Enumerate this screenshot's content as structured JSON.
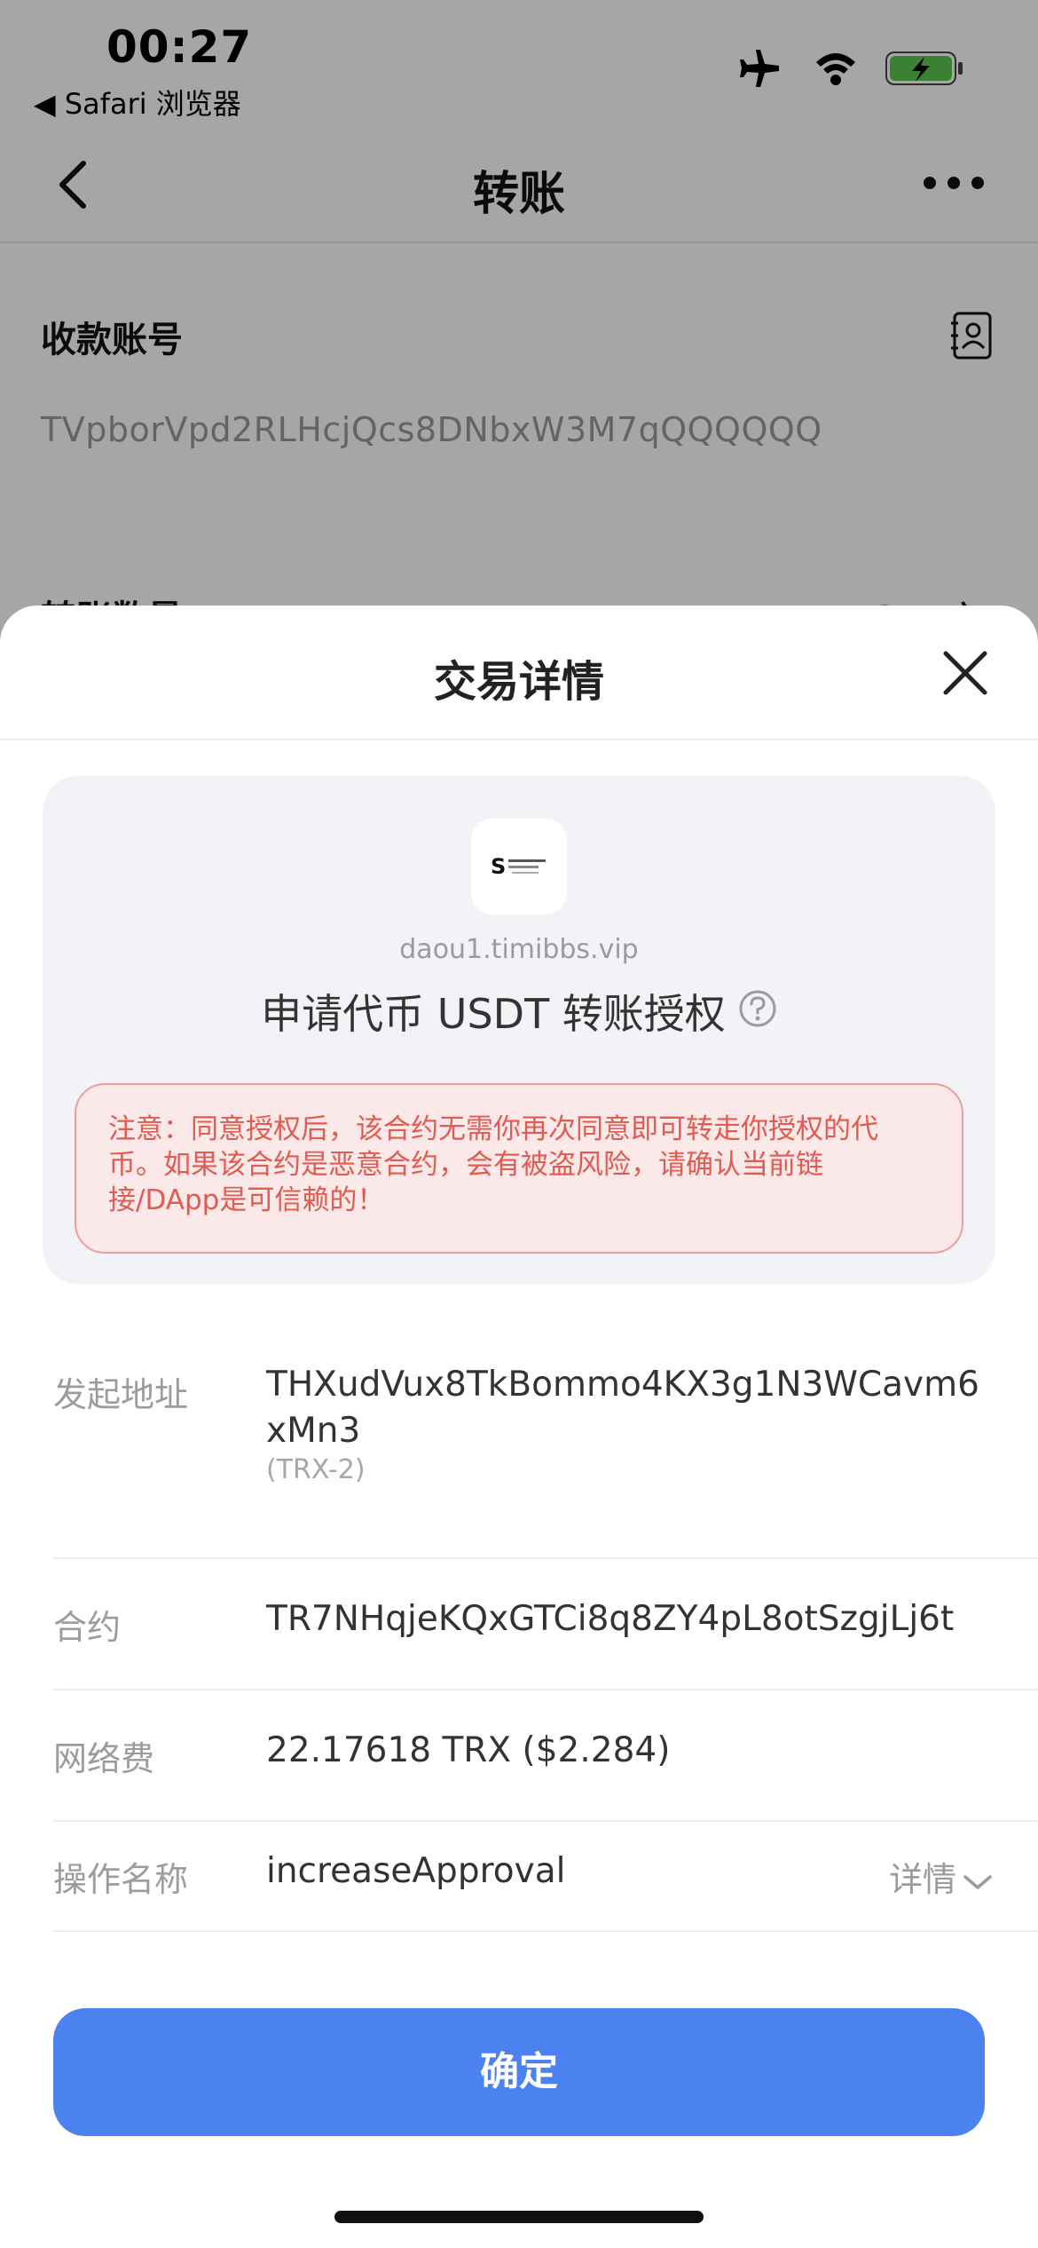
{
  "status_bar": {
    "time": "00:27",
    "back_app": "◀ Safari 浏览器",
    "icons": [
      "airplane-icon",
      "wifi-icon",
      "battery-charging-icon"
    ],
    "battery_color": "#5ac74f"
  },
  "nav": {
    "title": "转账",
    "back_icon": "chevron-left-icon",
    "more_icon": "more-horizontal-icon"
  },
  "transfer_form": {
    "account_label": "收款账号",
    "account_value": "TVpborVpd2RLHcjQcs8DNbxW3M7qQQQQQQ",
    "amount_label": "转账数量",
    "token_selector": "USDT 〉"
  },
  "sheet": {
    "title": "交易详情",
    "close_icon": "close-icon",
    "site_domain": "daou1.timibbs.vip",
    "request_title": "申请代币 USDT 转账授权",
    "help_icon": "question-circle-icon",
    "warning_text": "注意：同意授权后，该合约无需你再次同意即可转走你授权的代币。如果该合约是恶意合约，会有被盗风险，请确认当前链接/DApp是可信赖的！",
    "rows": [
      {
        "label": "发起地址",
        "value": "THXudVux8TkBommo4KX3g1N3WCavm6xMn3",
        "sub": "(TRX-2)"
      },
      {
        "label": "合约",
        "value": "TR7NHqjeKQxGTCi8q8ZY4pL8otSzgjLj6t"
      },
      {
        "label": "网络费",
        "value": "22.17618 TRX ($2.284)"
      },
      {
        "label": "操作名称",
        "value": "increaseApproval",
        "detail": "详情"
      }
    ],
    "confirm_label": "确定"
  },
  "colors": {
    "primary": "#4b82ef",
    "warning_text": "#e25a50",
    "warning_bg": "#fbe9e9",
    "warning_border": "#f09c9c"
  }
}
